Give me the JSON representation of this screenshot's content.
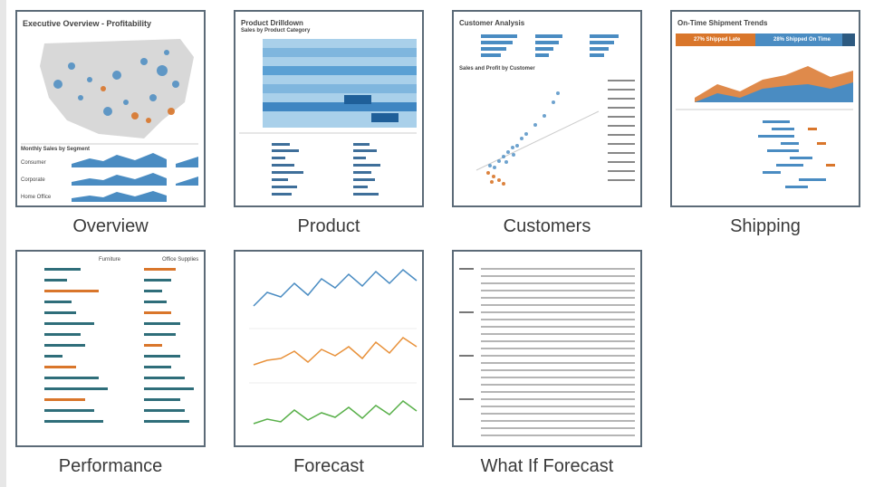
{
  "colors": {
    "accent": "#4a8cc2",
    "orange": "#d9762b",
    "teal": "#2f6e7a",
    "green": "#59b04a",
    "border": "#5c6b78"
  },
  "thumbs": [
    {
      "name": "Overview",
      "title": "Executive Overview - Profitability",
      "sub": "Monthly Sales by Segment",
      "segments": [
        "Consumer",
        "Corporate",
        "Home Office"
      ]
    },
    {
      "name": "Product",
      "title": "Product Drilldown",
      "sub": "Sales by Product Category"
    },
    {
      "name": "Customers",
      "title": "Customer Analysis",
      "sub": "Sales and Profit by Customer"
    },
    {
      "name": "Shipping",
      "title": "On-Time Shipment Trends",
      "late": "27% Shipped Late",
      "ontime": "28% Shipped On Time"
    },
    {
      "name": "Performance",
      "cols": [
        "Furniture",
        "Office Supplies"
      ]
    },
    {
      "name": "Forecast"
    },
    {
      "name": "What If Forecast"
    }
  ]
}
